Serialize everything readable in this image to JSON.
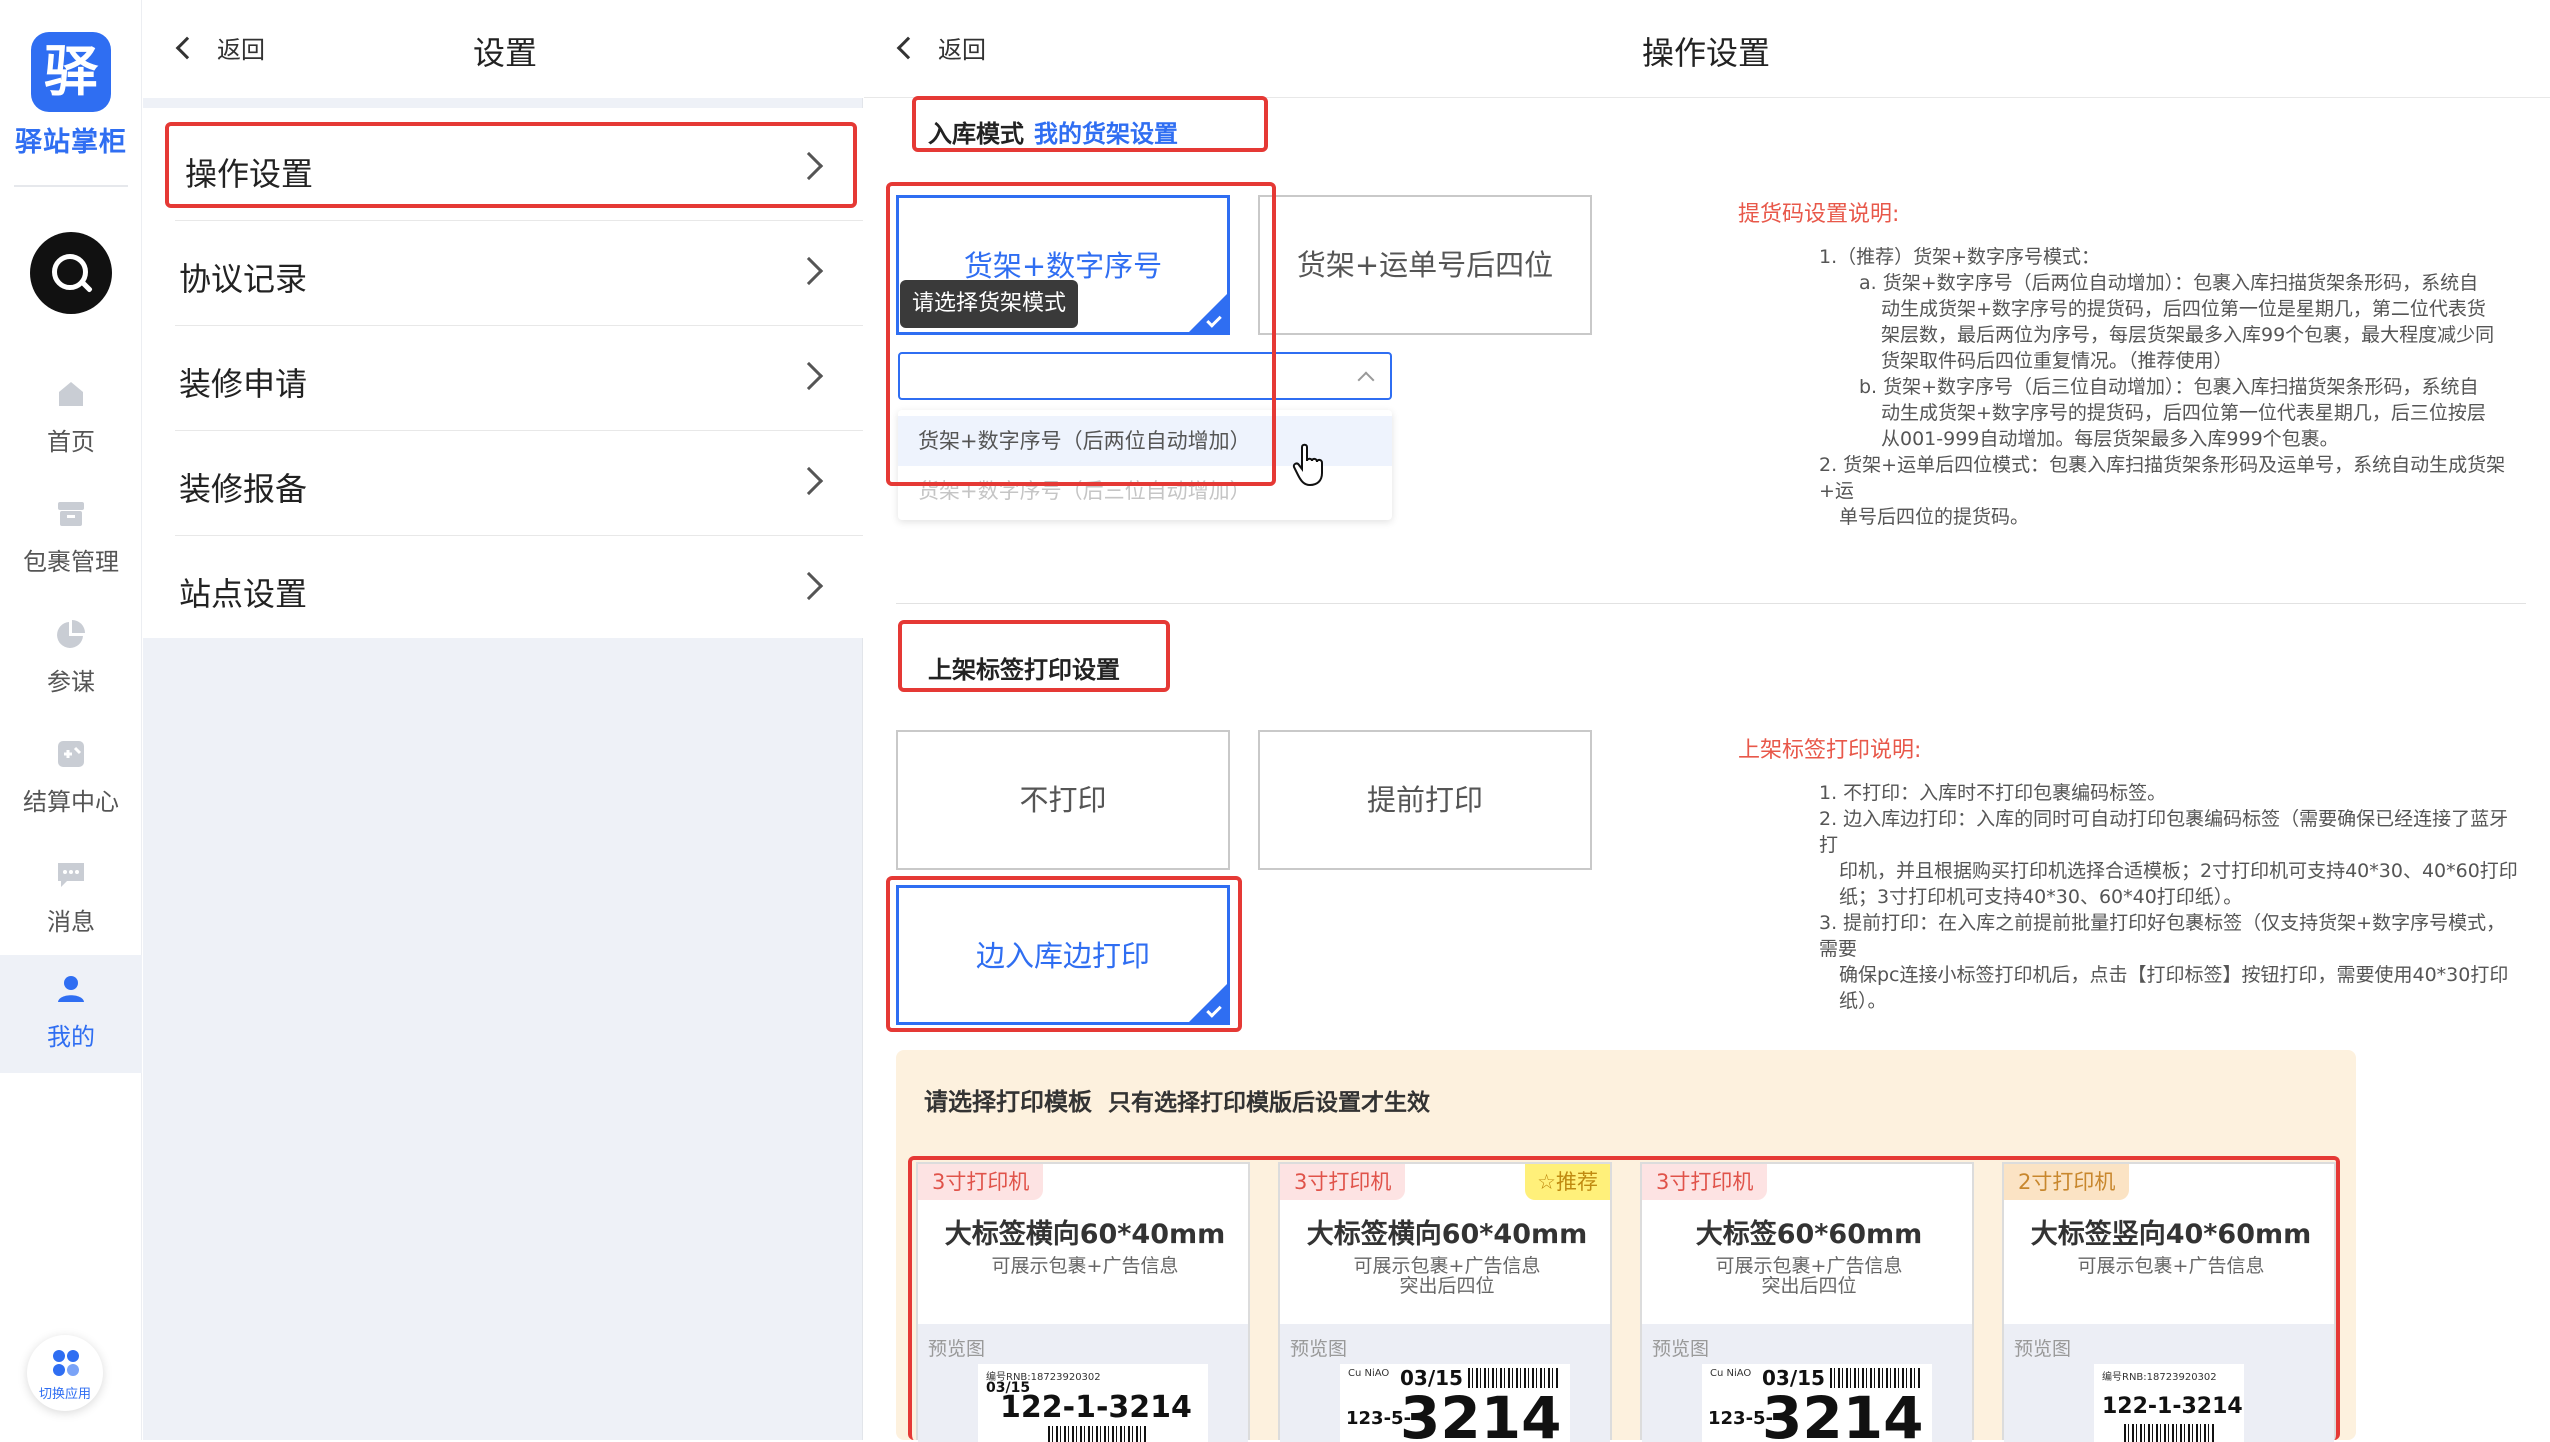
{
  "rail": {
    "logo_glyph": "驿",
    "app_name": "驿站掌柜",
    "items": [
      {
        "label": "首页",
        "icon": "home-icon"
      },
      {
        "label": "包裹管理",
        "icon": "package-icon"
      },
      {
        "label": "参谋",
        "icon": "pie-chart-icon"
      },
      {
        "label": "结算中心",
        "icon": "settlement-icon"
      },
      {
        "label": "消息",
        "icon": "message-icon"
      },
      {
        "label": "我的",
        "icon": "user-icon"
      }
    ],
    "switch_app_label": "切换应用",
    "accent": "#2f6ef2"
  },
  "settings_panel": {
    "back_label": "返回",
    "title": "设置",
    "items": [
      {
        "label": "操作设置"
      },
      {
        "label": "协议记录"
      },
      {
        "label": "装修申请"
      },
      {
        "label": "装修报备"
      },
      {
        "label": "站点设置"
      }
    ]
  },
  "main": {
    "back_label": "返回",
    "title": "操作设置",
    "inbound": {
      "label": "入库模式",
      "link": "我的货架设置",
      "options": [
        "货架+数字序号",
        "货架+运单号后四位"
      ],
      "selected": "货架+数字序号",
      "tooltip": "请选择货架模式",
      "dropdown_options": [
        "货架+数字序号（后两位自动增加）",
        "货架+数字序号（后三位自动增加）"
      ]
    },
    "pickup_explain": {
      "title": "提货码设置说明:",
      "lines": [
        "1.（推荐）货架+数字序号模式：",
        "a. 货架+数字序号（后两位自动增加）：包裹入库扫描货架条形码，系统自",
        "动生成货架+数字序号的提货码，后四位第一位是星期几，第二位代表货",
        "架层数，最后两位为序号，每层货架最多入库99个包裹，最大程度减少同",
        "货架取件码后四位重复情况。（推荐使用）",
        "b. 货架+数字序号（后三位自动增加）：包裹入库扫描货架条形码，系统自",
        "动生成货架+数字序号的提货码，后四位第一位代表星期几，后三位按层",
        "从001-999自动增加。每层货架最多入库999个包裹。",
        "2. 货架+运单后四位模式：包裹入库扫描货架条形码及运单号，系统自动生成货架+运",
        "单号后四位的提货码。"
      ]
    },
    "print": {
      "label": "上架标签打印设置",
      "options": [
        "不打印",
        "提前打印",
        "边入库边打印"
      ],
      "selected": "边入库边打印"
    },
    "print_explain": {
      "title": "上架标签打印说明:",
      "lines": [
        "1. 不打印：入库时不打印包裹编码标签。",
        "2. 边入库边打印：入库的同时可自动打印包裹编码标签（需要确保已经连接了蓝牙打",
        "印机，并且根据购买打印机选择合适模板；2寸打印机可支持40*30、40*60打印",
        "纸；3寸打印机可支持40*30、60*40打印纸）。",
        "3. 提前打印：在入库之前提前批量打印好包裹标签（仅支持货架+数字序号模式，需要",
        "确保pc连接小标签打印机后，点击【打印标签】按钮打印，需要使用40*30打印",
        "纸）。"
      ]
    },
    "templates": {
      "title": "请选择打印模板",
      "subtitle": "只有选择打印模版后设置才生效",
      "preview_label": "预览图",
      "recommend_label": "推荐",
      "cards": [
        {
          "printer": "3寸打印机",
          "name": "大标签横向60*40mm",
          "desc": [
            "可展示包裹+广告信息"
          ],
          "recommended": false,
          "sample": {
            "small": "编号RNB:18723920302",
            "date": "03/15",
            "code": "122-1-3214"
          }
        },
        {
          "printer": "3寸打印机",
          "name": "大标签横向60*40mm",
          "desc": [
            "可展示包裹+广告信息",
            "突出后四位"
          ],
          "recommended": true,
          "sample": {
            "small": "Cu NiAO",
            "date": "03/15",
            "prefix": "123-5-",
            "code": "3214"
          }
        },
        {
          "printer": "3寸打印机",
          "name": "大标签60*60mm",
          "desc": [
            "可展示包裹+广告信息",
            "突出后四位"
          ],
          "recommended": false,
          "sample": {
            "small": "Cu NiAO",
            "date": "03/15",
            "prefix": "123-5-",
            "code": "3214"
          }
        },
        {
          "printer": "2寸打印机",
          "name": "大标签竖向40*60mm",
          "desc": [
            "可展示包裹+广告信息"
          ],
          "recommended": false,
          "sample": {
            "small": "编号RNB:18723920302",
            "date": "",
            "code": "122-1-3214"
          }
        }
      ]
    }
  }
}
